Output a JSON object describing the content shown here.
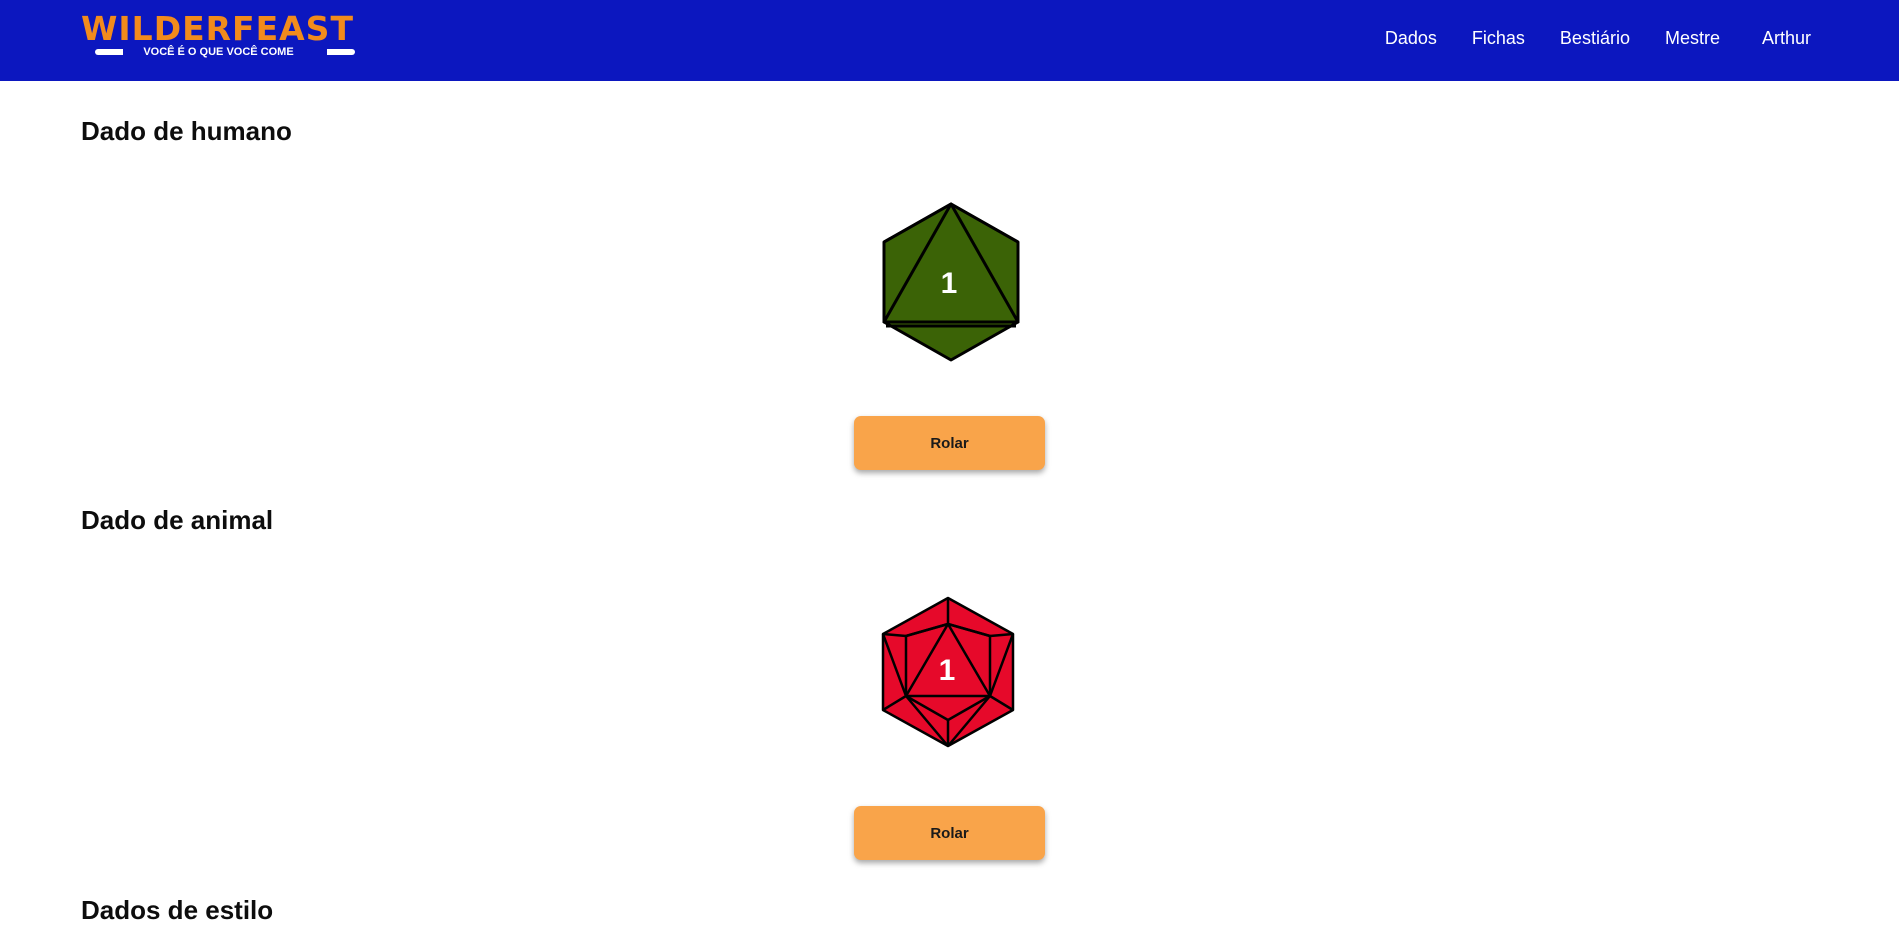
{
  "header": {
    "logo_title": "WILDERFEAST",
    "logo_subtitle": "VOCÊ É O QUE VOCÊ COME",
    "nav_items": [
      "Dados",
      "Fichas",
      "Bestiário",
      "Mestre"
    ],
    "user_name": "Arthur",
    "colors": {
      "background": "#0c17bf",
      "logo": "#f28b1c"
    }
  },
  "sections": [
    {
      "title": "Dado de humano",
      "die": {
        "type": "d8",
        "value": "1",
        "color": "#3b6306",
        "icon": "d8-die-icon"
      },
      "roll_label": "Rolar"
    },
    {
      "title": "Dado de animal",
      "die": {
        "type": "d20",
        "value": "1",
        "color": "#e6092a",
        "icon": "d20-die-icon"
      },
      "roll_label": "Rolar"
    },
    {
      "title": "Dados de estilo"
    }
  ],
  "colors": {
    "button": "#f9a44a"
  }
}
